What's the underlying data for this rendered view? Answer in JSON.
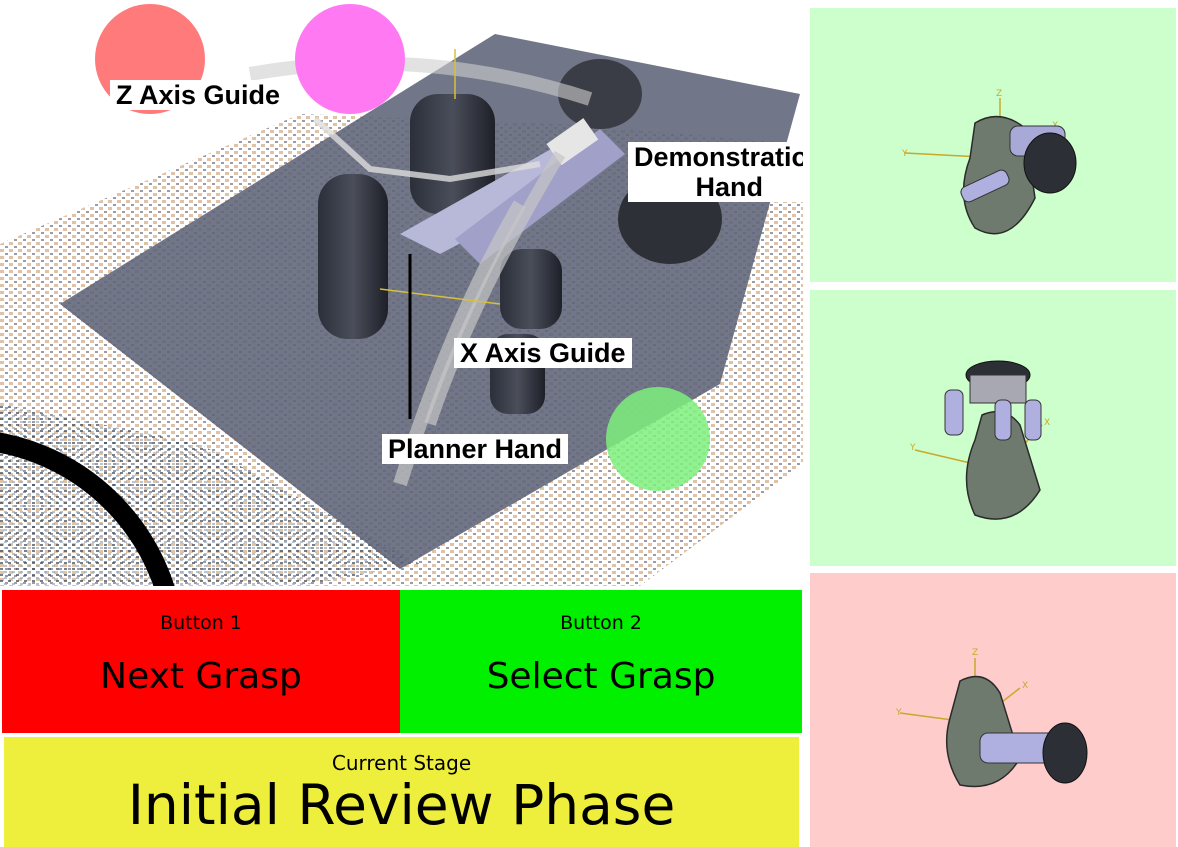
{
  "scene": {
    "labels": {
      "z_axis": "Z Axis Guide",
      "demo_hand_line1": "Demonstration",
      "demo_hand_line2": "Hand",
      "x_axis": "X Axis Guide",
      "planner_hand": "Planner Hand"
    },
    "colors": {
      "z_guide_circle": "#ff7a7a",
      "magenta_circle": "#ff7af2",
      "x_guide_circle": "#7ef07e"
    }
  },
  "buttons": {
    "button1": {
      "caption": "Button 1",
      "label": "Next Grasp",
      "color": "#ff0000"
    },
    "button2": {
      "caption": "Button 2",
      "label": "Select Grasp",
      "color": "#00f000"
    }
  },
  "stage": {
    "caption": "Current Stage",
    "value": "Initial Review Phase",
    "color": "#eeee3c"
  },
  "views": [
    {
      "axes": [
        "Z",
        "Y",
        "X"
      ],
      "color": "#ccffcc",
      "icon": "grasp-preview"
    },
    {
      "axes": [
        "Y",
        "X"
      ],
      "color": "#ccffcc",
      "icon": "grasp-preview"
    },
    {
      "axes": [
        "Z",
        "Y",
        "X"
      ],
      "color": "#ffcccc",
      "icon": "grasp-preview"
    }
  ]
}
